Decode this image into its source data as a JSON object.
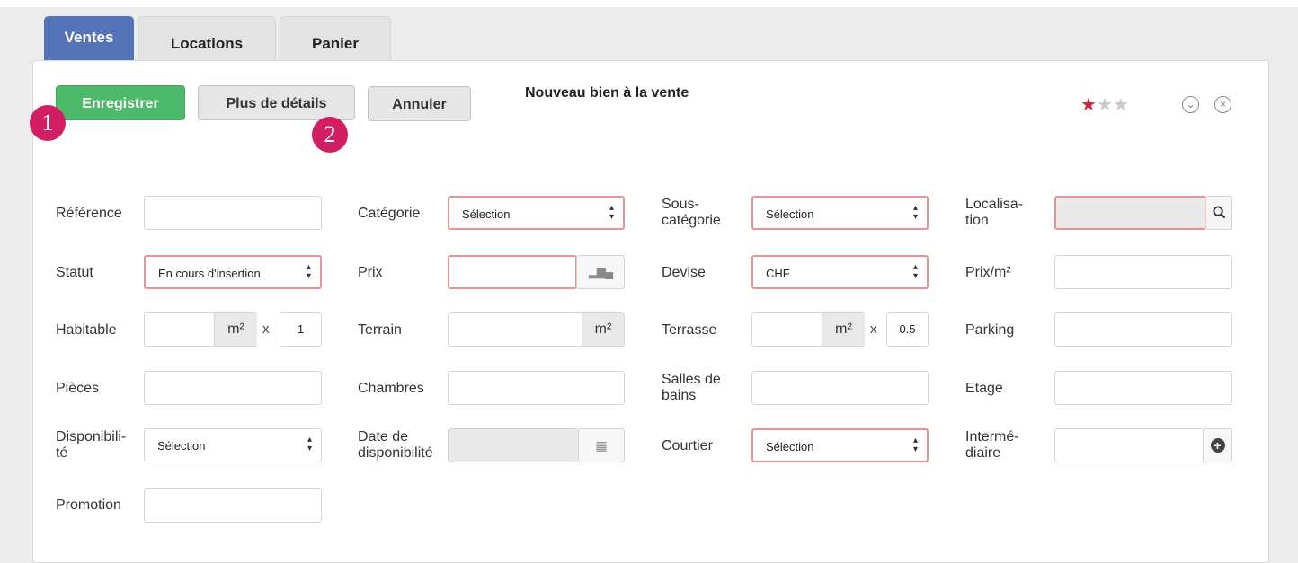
{
  "tabs": [
    {
      "label": "Ventes",
      "active": true
    },
    {
      "label": "Locations",
      "active": false
    },
    {
      "label": "Panier",
      "active": false
    }
  ],
  "toolbar": {
    "save_label": "Enregistrer",
    "details_label": "Plus de détails",
    "cancel_label": "Annuler",
    "title": "Nouveau bien à la vente"
  },
  "callouts": [
    "1",
    "2"
  ],
  "rating": {
    "value": 1,
    "max": 3,
    "filled_color": "#c9283a"
  },
  "header_icons": {
    "expand": "chevron-down-circle-icon",
    "close": "close-circle-icon"
  },
  "fields": {
    "reference": {
      "label": "Référence",
      "value": ""
    },
    "categorie": {
      "label": "Catégorie",
      "value": "Sélection"
    },
    "sous_categorie": {
      "label_1": "Sous-",
      "label_2": "catégorie",
      "value": "Sélection"
    },
    "localisation": {
      "label_1": "Localisa-",
      "label_2": "tion",
      "value": ""
    },
    "statut": {
      "label": "Statut",
      "value": "En cours d'insertion"
    },
    "prix": {
      "label": "Prix",
      "value": ""
    },
    "devise": {
      "label": "Devise",
      "value": "CHF"
    },
    "prix_m2": {
      "label": "Prix/m²",
      "value": ""
    },
    "habitable": {
      "label": "Habitable",
      "unit": "m²",
      "multiplier_sign": "x",
      "multiplier": "1"
    },
    "terrain": {
      "label": "Terrain",
      "unit": "m²"
    },
    "terrasse": {
      "label": "Terrasse",
      "unit": "m²",
      "multiplier_sign": "x",
      "multiplier": "0.5"
    },
    "parking": {
      "label": "Parking",
      "value": ""
    },
    "pieces": {
      "label": "Pièces",
      "value": ""
    },
    "chambres": {
      "label": "Chambres",
      "value": ""
    },
    "salles_de_bains": {
      "label_1": "Salles de",
      "label_2": "bains",
      "value": ""
    },
    "etage": {
      "label": "Etage",
      "value": ""
    },
    "disponibilite": {
      "label_1": "Disponibili-",
      "label_2": "té",
      "value": "Sélection"
    },
    "date_disponibilite": {
      "label_1": "Date de",
      "label_2": "disponibilité",
      "value": ""
    },
    "courtier": {
      "label": "Courtier",
      "value": "Sélection"
    },
    "intermediaire": {
      "label_1": "Intermé-",
      "label_2": "diaire",
      "value": ""
    },
    "promotion": {
      "label": "Promotion",
      "value": ""
    }
  },
  "colors": {
    "primary_tab": "#5573b8",
    "save_button": "#4cba6a",
    "required_border": "#e59494",
    "callout": "#d21f63"
  }
}
